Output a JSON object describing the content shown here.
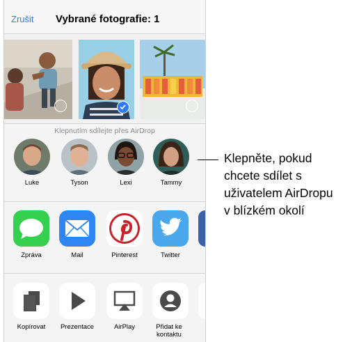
{
  "header": {
    "cancel_label": "Zrušit",
    "title": "Vybrané fotografie: 1"
  },
  "photos": [
    {
      "name": "photo-friends",
      "selected": false
    },
    {
      "name": "photo-woman-hat",
      "selected": true
    },
    {
      "name": "photo-sign",
      "selected": false
    }
  ],
  "airdrop": {
    "label": "Klepnutím sdílejte přes AirDrop",
    "people": [
      "Luke",
      "Tyson",
      "Lexi",
      "Tammy"
    ]
  },
  "apps": [
    {
      "label": "Zpráva",
      "icon": "message-icon",
      "color": "#35d04f"
    },
    {
      "label": "Mail",
      "icon": "mail-icon",
      "color": "#2f86f3"
    },
    {
      "label": "Pinterest",
      "icon": "pinterest-icon",
      "color": "#c8232c"
    },
    {
      "label": "Twitter",
      "icon": "twitter-icon",
      "color": "#4aa7ec"
    }
  ],
  "actions": [
    {
      "label": "Kopírovat",
      "icon": "copy-icon"
    },
    {
      "label": "Prezentace",
      "icon": "play-icon"
    },
    {
      "label": "AirPlay",
      "icon": "airplay-icon"
    },
    {
      "label": "Přidat ke kontaktu",
      "icon": "contact-icon"
    }
  ],
  "callout": {
    "line1": "Klepněte, pokud",
    "line2": "chcete sdílet s",
    "line3": "uživatelem AirDropu",
    "line4": "v blízkém okolí"
  }
}
